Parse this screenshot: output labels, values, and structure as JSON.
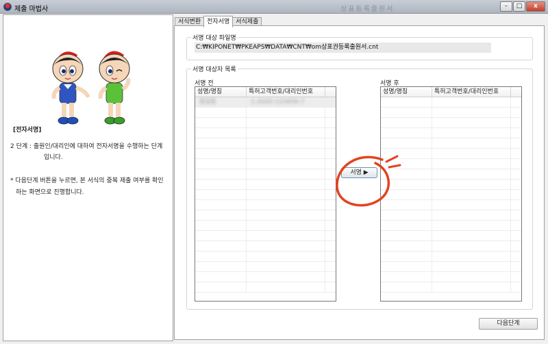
{
  "window": {
    "title": "제출 마법사",
    "center_title": "상표등록출원서",
    "minimize": "–",
    "maximize": "□",
    "close": "x"
  },
  "left": {
    "heading": "[전자서명]",
    "step_text": "2 단계 : 출원인/대리인에 대하여 전자서명을 수행하는 단계",
    "step_text_cont": "입니다.",
    "note_text": "* 다음단계 버튼을 누르면, 본 서식의 중복 제출 여부를 확인",
    "note_text_cont": "하는 화면으로 진행합니다."
  },
  "tabs": [
    "서식변환",
    "전자서명",
    "서식제출"
  ],
  "file_group": {
    "title": "서명 대상 파일명",
    "path": "C:₩KIPONET₩PKEAPS₩DATA₩CNT₩om상표권등록출원서.cnt"
  },
  "list_group": {
    "title": "서명 대상자 목록",
    "before_label": "서명 전",
    "after_label": "서명 후",
    "columns": [
      "성명/명칭",
      "특허고객번호/대리인번호"
    ],
    "before_rows": [
      [
        "홍길동",
        "1-2020-123456-7"
      ]
    ],
    "after_rows": []
  },
  "sign_button": "서명 ▶",
  "next_button": "다음단계",
  "colors": {
    "annotation": "#e2431f",
    "titlebar": "#bfc5cd"
  }
}
